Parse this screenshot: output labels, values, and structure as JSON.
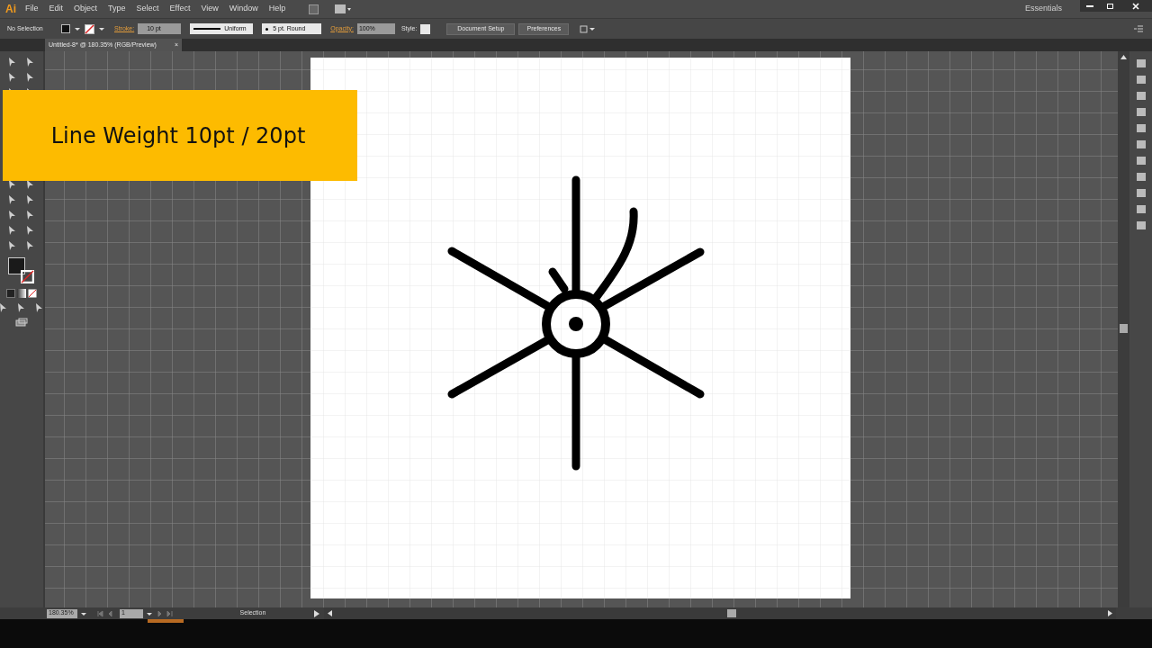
{
  "app": {
    "logo": "Ai",
    "workspace": "Essentials"
  },
  "menu": [
    "File",
    "Edit",
    "Object",
    "Type",
    "Select",
    "Effect",
    "View",
    "Window",
    "Help"
  ],
  "control_bar": {
    "selection": "No Selection",
    "stroke_label": "Stroke:",
    "stroke_weight": "10 pt",
    "profile": "Uniform",
    "brush": "5 pt. Round",
    "opacity_label": "Opacity:",
    "opacity": "100%",
    "style_label": "Style:",
    "buttons": [
      "Document Setup",
      "Preferences"
    ]
  },
  "document_tab": {
    "title": "Untitled-8* @ 180.35% (RGB/Preview)",
    "close": "×"
  },
  "caption": "Line Weight 10pt / 20pt",
  "status_bar": {
    "zoom": "180.35%",
    "page": "1",
    "status": "Selection"
  }
}
